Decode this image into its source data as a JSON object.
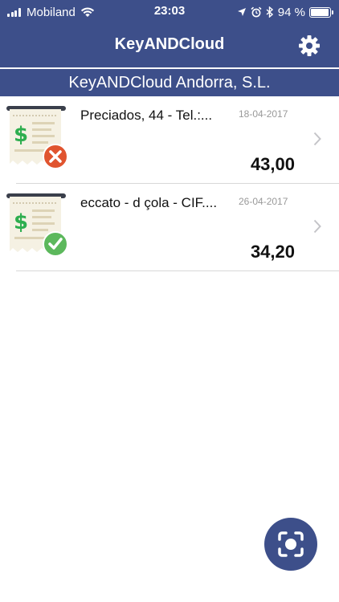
{
  "status_bar": {
    "carrier": "Mobiland",
    "time": "23:03",
    "battery_pct": "94 %",
    "battery_level": 0.94,
    "icons": [
      "signal-icon",
      "wifi-icon",
      "location-arrow-icon",
      "alarm-icon",
      "bluetooth-icon",
      "battery-icon"
    ]
  },
  "nav": {
    "title": "KeyANDCloud",
    "settings_icon": "gear-icon"
  },
  "company": {
    "name": "KeyANDCloud Andorra, S.L."
  },
  "tickets": [
    {
      "name": "Preciados, 44 - Tel.:...",
      "date": "18-04-2017",
      "amount": "43,00",
      "status": "error",
      "status_color": "#e0542f"
    },
    {
      "name": "eccato - d çola - CIF....",
      "date": "26-04-2017",
      "amount": "34,20",
      "status": "ok",
      "status_color": "#5cb85c"
    }
  ],
  "fab": {
    "icon": "scan-camera-icon",
    "color": "#3d4f8a"
  },
  "colors": {
    "brand": "#3d4f8a",
    "receipt_paper": "#f5f1e3",
    "dollar_green": "#2eae4f"
  }
}
